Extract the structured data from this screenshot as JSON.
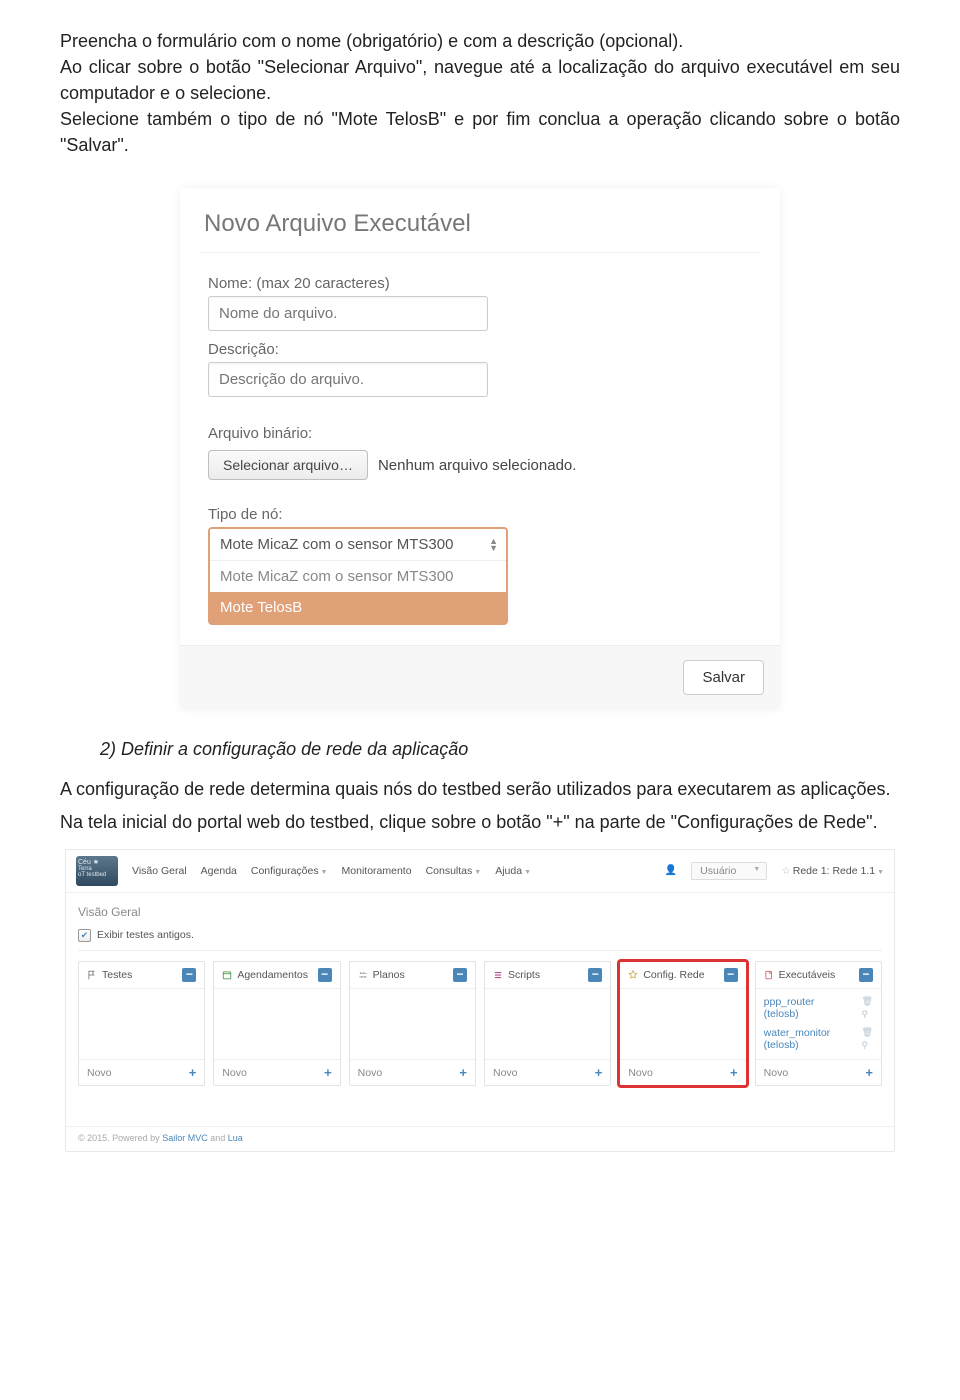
{
  "intro": {
    "p1": "Preencha o formulário com o nome (obrigatório) e com a descrição (opcional).",
    "p2": "Ao clicar sobre o botão \"Selecionar Arquivo\", navegue até a localização do arquivo executável em seu computador e o selecione.",
    "p3": "Selecione também o tipo de nó \"Mote TelosB\" e por fim conclua a operação clicando sobre o botão \"Salvar\"."
  },
  "form": {
    "title": "Novo Arquivo Executável",
    "name_label": "Nome: (max 20 caracteres)",
    "name_placeholder": "Nome do arquivo.",
    "desc_label": "Descrição:",
    "desc_placeholder": "Descrição do arquivo.",
    "bin_label": "Arquivo binário:",
    "file_button": "Selecionar arquivo…",
    "file_status": "Nenhum arquivo selecionado.",
    "type_label": "Tipo de nó:",
    "type_selected": "Mote MicaZ com o sensor MTS300",
    "type_opt1": "Mote MicaZ com o sensor MTS300",
    "type_opt2": "Mote TelosB",
    "save": "Salvar"
  },
  "section2": {
    "heading": "2) Definir a configuração de rede da aplicação",
    "p1": "A configuração de rede determina quais nós do testbed serão utilizados para executarem as aplicações.",
    "p2": "Na tela inicial do portal web do testbed, clique sobre o botão \"+\"  na parte de \"Configurações de Rede\"."
  },
  "portal": {
    "brand1": "Céu ★",
    "brand2": "Terra",
    "brand3": "oT testbed",
    "nav": {
      "visao": "Visão Geral",
      "agenda": "Agenda",
      "config": "Configurações",
      "monitor": "Monitoramento",
      "consultas": "Consultas",
      "ajuda": "Ajuda"
    },
    "user_label": "Usuário",
    "rede": "Rede 1: Rede 1.1",
    "vg_title": "Visão Geral",
    "exibir": "Exibir testes antigos.",
    "cards": {
      "testes": "Testes",
      "agendamentos": "Agendamentos",
      "planos": "Planos",
      "scripts": "Scripts",
      "configrede": "Config. Rede",
      "executaveis": "Executáveis",
      "novo": "Novo"
    },
    "exec_items": {
      "a1": "ppp_router",
      "a2": "(telosb)",
      "b1": "water_monitor",
      "b2": "(telosb)"
    },
    "footer": {
      "year": "© 2015. Powered by ",
      "sailor": "Sailor MVC",
      "and": " and ",
      "lua": "Lua"
    }
  }
}
